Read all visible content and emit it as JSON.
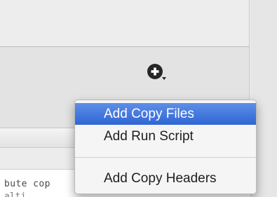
{
  "toolbar": {
    "add_button_icon": "plus-circle-dropdown-icon"
  },
  "build_phases_menu": {
    "items": [
      {
        "label": "Add Copy Files",
        "selected": true
      },
      {
        "label": "Add Run Script",
        "selected": false
      },
      {
        "label": "Add Copy Headers",
        "selected": false
      }
    ]
  },
  "editor": {
    "line1": "bute cop",
    "line2": "alti"
  },
  "colors": {
    "selection_top": "#5d8ee8",
    "selection_bottom": "#2f66d4",
    "menu_background": "#f5f5f5",
    "panel_background": "#e3e3e3"
  }
}
